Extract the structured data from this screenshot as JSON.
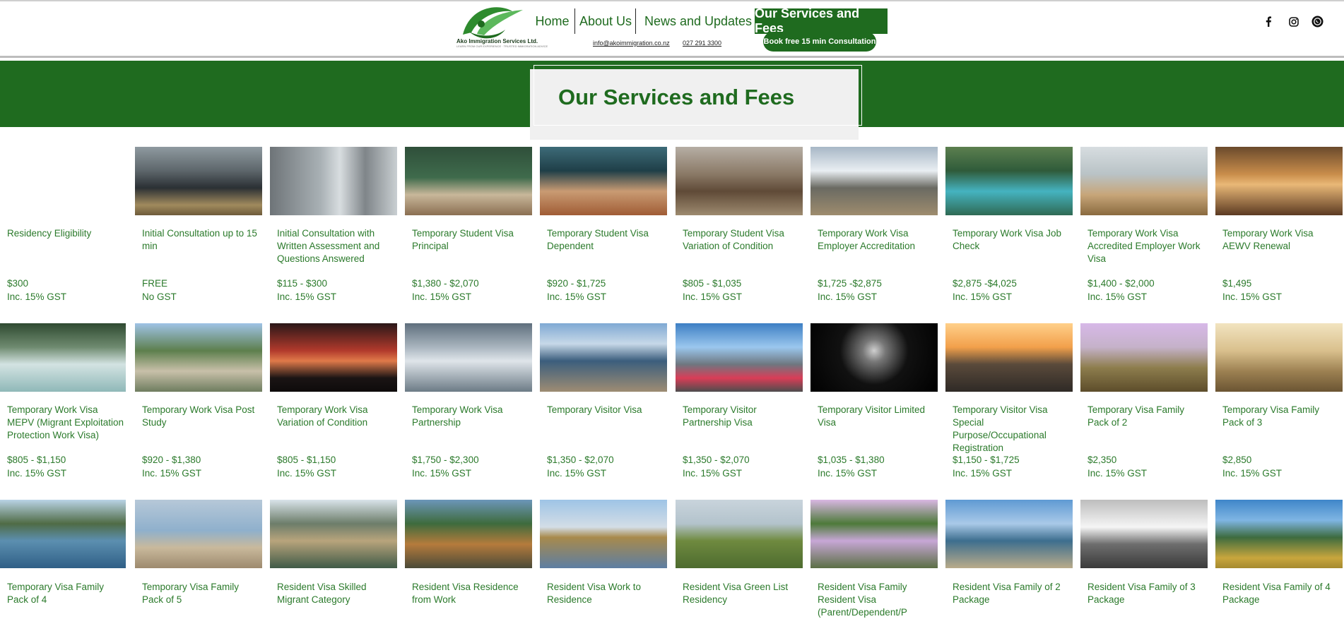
{
  "header": {
    "brand_name": "Ako Immigration Services Ltd.",
    "brand_tagline": "LEARN FROM OUR EXPERIENCE · TRUSTED IMMIGRATION ADVICE",
    "nav": {
      "home": "Home",
      "about": "About Us",
      "news": "News and Updates",
      "services": "Our Services and Fees"
    },
    "email": "info@akoimmigration.co.nz",
    "phone": "027 291 3300",
    "cta": "Book free 15 min Consultation",
    "social": [
      "facebook-icon",
      "instagram-icon",
      "whatsapp-icon"
    ]
  },
  "page": {
    "title": "Our Services and Fees"
  },
  "colors": {
    "brand_green": "#1f6b1f",
    "text_green": "#2b7a2b"
  },
  "services": [
    {
      "name": "Residency Eligibility",
      "price": "$300",
      "gst": "Inc. 15% GST",
      "image": "none"
    },
    {
      "name": "Initial Consultation up to 15 min",
      "price": "FREE",
      "gst": "No GST",
      "image": "office-meeting"
    },
    {
      "name": "Initial Consultation with Written Assessment and Questions Answered",
      "price": "$115 - $300",
      "gst": "Inc. 15% GST",
      "image": "office-door"
    },
    {
      "name": "Temporary Student Visa Principal",
      "price": "$1,380 - $2,070",
      "gst": "Inc. 15% GST",
      "image": "classroom"
    },
    {
      "name": "Temporary Student Visa Dependent",
      "price": "$920 - $1,725",
      "gst": "Inc. 15% GST",
      "image": "teach-blocks"
    },
    {
      "name": "Temporary Student Visa Variation of Condition",
      "price": "$805 - $1,035",
      "gst": "Inc. 15% GST",
      "image": "university"
    },
    {
      "name": "Temporary Work Visa Employer Accreditation",
      "price": "$1,725 -$2,875",
      "gst": "Inc. 15% GST",
      "image": "mountains"
    },
    {
      "name": "Temporary Work Visa Job Check",
      "price": "$2,875 -$4,025",
      "gst": "Inc. 15% GST",
      "image": "river-forest"
    },
    {
      "name": "Temporary Work Visa Accredited Employer Work Visa",
      "price": "$1,400 - $2,000",
      "gst": "Inc. 15% GST",
      "image": "beach-grass"
    },
    {
      "name": "Temporary Work Visa AEWV Renewal",
      "price": "$1,495",
      "gst": "Inc. 15% GST",
      "image": "beach-sunset"
    },
    {
      "name": "Temporary Work Visa MEPV (Migrant Exploitation Protection Work Visa)",
      "price": "$805 - $1,150",
      "gst": "Inc. 15% GST",
      "image": "waterfall"
    },
    {
      "name": "Temporary Work Visa Post Study",
      "price": "$920 - $1,380",
      "gst": "Inc. 15% GST",
      "image": "town-hills"
    },
    {
      "name": "Temporary Work Visa Variation of Condition",
      "price": "$805 - $1,150",
      "gst": "Inc. 15% GST",
      "image": "red-sky"
    },
    {
      "name": "Temporary Work Visa Partnership",
      "price": "$1,750 - $2,300",
      "gst": "Inc. 15% GST",
      "image": "lake-cloudy"
    },
    {
      "name": "Temporary Visitor Visa",
      "price": "$1,350 - $2,070",
      "gst": "Inc. 15% GST",
      "image": "harbor"
    },
    {
      "name": "Temporary Visitor Partnership Visa",
      "price": "$1,350 - $2,070",
      "gst": "Inc. 15% GST",
      "image": "city-highway"
    },
    {
      "name": "Temporary Visitor Limited Visa",
      "price": "$1,035 - $1,380",
      "gst": "Inc. 15% GST",
      "image": "sky-tower"
    },
    {
      "name": "Temporary Visitor Visa Special Purpose/Occupational Registration",
      "price": "$1,150 - $1,725",
      "gst": "Inc. 15% GST",
      "image": "city-sunset"
    },
    {
      "name": "Temporary Visa Family Pack of 2",
      "price": "$2,350",
      "gst": "Inc. 15% GST",
      "image": "family-bikes"
    },
    {
      "name": "Temporary Visa Family Pack of 3",
      "price": "$2,850",
      "gst": "Inc. 15% GST",
      "image": "tree-field"
    },
    {
      "name": "Temporary Visa Family Pack of 4",
      "image": "coast-cliff"
    },
    {
      "name": "Temporary Visa Family Pack of 5",
      "image": "beach-people"
    },
    {
      "name": "Resident Visa Skilled Migrant Category",
      "image": "glacier-valley"
    },
    {
      "name": "Resident Visa Residence from Work",
      "image": "thermal-pools"
    },
    {
      "name": "Resident Visa Work to Residence",
      "image": "lone-tree"
    },
    {
      "name": "Resident Visa Green List Residency",
      "image": "green-hills"
    },
    {
      "name": "Resident Visa Family Resident Visa (Parent/Dependent/P",
      "image": "pink-lake"
    },
    {
      "name": "Resident Visa Family of 2 Package",
      "image": "coastline"
    },
    {
      "name": "Resident Visa Family of 3 Package",
      "image": "snow-peak"
    },
    {
      "name": "Resident Visa Family of 4 Package",
      "image": "golden-valley"
    }
  ]
}
